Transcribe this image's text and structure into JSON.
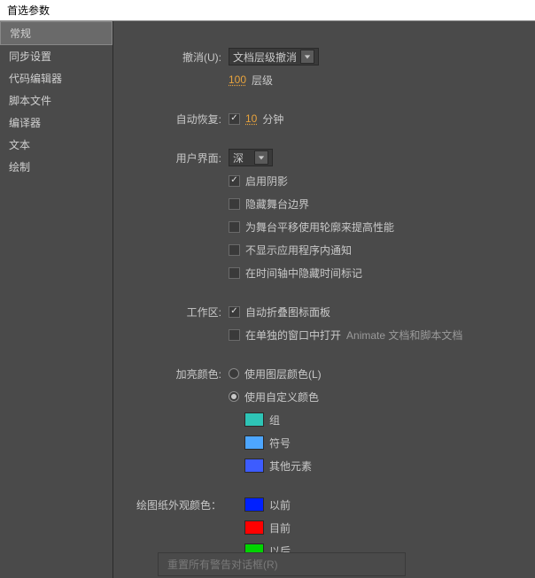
{
  "title": "首选参数",
  "sidebar": {
    "items": [
      {
        "label": "常规"
      },
      {
        "label": "同步设置"
      },
      {
        "label": "代码编辑器"
      },
      {
        "label": "脚本文件"
      },
      {
        "label": "编译器"
      },
      {
        "label": "文本"
      },
      {
        "label": "绘制"
      }
    ]
  },
  "undo": {
    "label": "撤消(U):",
    "dropdown": "文档层级撤消",
    "levels_num": "100",
    "levels_text": "层级"
  },
  "autorecover": {
    "label": "自动恢复:",
    "minutes_num": "10",
    "minutes_text": "分钟"
  },
  "ui": {
    "label": "用户界面:",
    "dropdown": "深",
    "opts": [
      "启用阴影",
      "隐藏舞台边界",
      "为舞台平移使用轮廓来提高性能",
      "不显示应用程序内通知",
      "在时间轴中隐藏时间标记"
    ]
  },
  "workspace": {
    "label": "工作区:",
    "opt1": "自动折叠图标面板",
    "opt2_a": "在单独的窗口中打开",
    "opt2_b": "Animate 文档和脚本文档"
  },
  "highlight": {
    "label": "加亮颜色:",
    "radio1": "使用图层颜色(L)",
    "radio2": "使用自定义颜色",
    "swatches": [
      {
        "color": "#2ec4b6",
        "label": "组"
      },
      {
        "color": "#4da6ff",
        "label": "符号"
      },
      {
        "color": "#3d5cff",
        "label": "其他元素"
      }
    ]
  },
  "onion": {
    "label": "绘图纸外观颜色：",
    "swatches": [
      {
        "color": "#0020ff",
        "label": "以前"
      },
      {
        "color": "#ff0000",
        "label": "目前"
      },
      {
        "color": "#00d400",
        "label": "以后"
      }
    ]
  },
  "reset_btn": "重置所有警告对话框(R)"
}
